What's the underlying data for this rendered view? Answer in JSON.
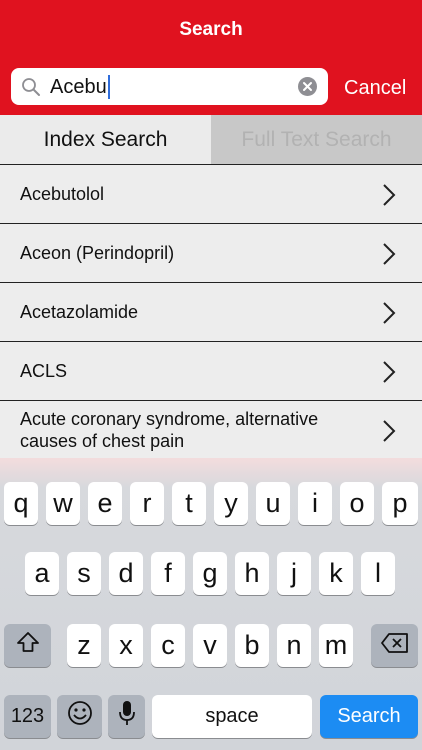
{
  "header": {
    "title": "Search"
  },
  "search": {
    "query": "Acebu",
    "cancel_label": "Cancel"
  },
  "segments": [
    {
      "label": "Index Search",
      "active": true
    },
    {
      "label": "Full Text Search",
      "active": false
    }
  ],
  "results": [
    {
      "label": "Acebutolol"
    },
    {
      "label": "Aceon (Perindopril)"
    },
    {
      "label": "Acetazolamide"
    },
    {
      "label": "ACLS"
    },
    {
      "label": "Acute coronary syndrome, alternative causes of chest pain"
    }
  ],
  "keyboard": {
    "row1": [
      "q",
      "w",
      "e",
      "r",
      "t",
      "y",
      "u",
      "i",
      "o",
      "p"
    ],
    "row2": [
      "a",
      "s",
      "d",
      "f",
      "g",
      "h",
      "j",
      "k",
      "l"
    ],
    "row3": [
      "z",
      "x",
      "c",
      "v",
      "b",
      "n",
      "m"
    ],
    "numbers_label": "123",
    "space_label": "space",
    "action_label": "Search"
  }
}
